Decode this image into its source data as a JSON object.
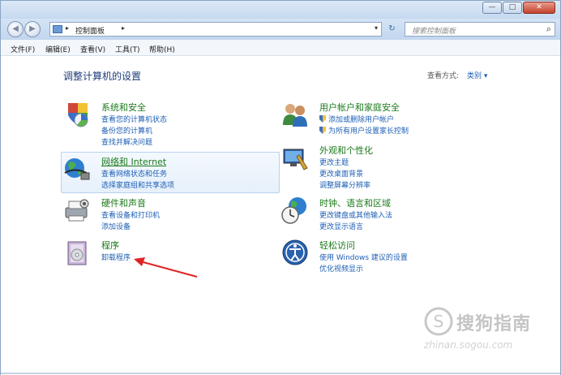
{
  "window": {
    "minimize_glyph": "—",
    "maximize_glyph": "□",
    "close_glyph": "✕"
  },
  "nav": {
    "back_glyph": "◀",
    "forward_glyph": "▶",
    "address_sep": "▸",
    "address_text": "控制面板",
    "address_sep2": "▸",
    "dropdown_glyph": "▾",
    "refresh_glyph": "↻",
    "search_placeholder": "搜索控制面板",
    "search_glyph": "⌕"
  },
  "menu": [
    "文件(F)",
    "编辑(E)",
    "查看(V)",
    "工具(T)",
    "帮助(H)"
  ],
  "page": {
    "heading": "调整计算机的设置",
    "view_label": "查看方式:",
    "view_value": "类别 ▾"
  },
  "categories": [
    {
      "title": "系统和安全",
      "links": [
        "查看您的计算机状态",
        "备份您的计算机",
        "查找并解决问题"
      ],
      "icon": "system-security-icon"
    },
    {
      "title": "网络和 Internet",
      "links": [
        "查看网络状态和任务",
        "选择家庭组和共享选项"
      ],
      "icon": "network-icon"
    },
    {
      "title": "硬件和声音",
      "links": [
        "查看设备和打印机",
        "添加设备"
      ],
      "icon": "hardware-sound-icon"
    },
    {
      "title": "程序",
      "links": [
        "卸载程序"
      ],
      "icon": "programs-icon"
    },
    {
      "title": "用户帐户和家庭安全",
      "links": [
        "添加或删除用户帐户",
        "为所有用户设置家长控制"
      ],
      "icon": "user-accounts-icon"
    },
    {
      "title": "外观和个性化",
      "links": [
        "更改主题",
        "更改桌面背景",
        "调整屏幕分辨率"
      ],
      "icon": "appearance-icon"
    },
    {
      "title": "时钟、语言和区域",
      "links": [
        "更改键盘或其他输入法",
        "更改显示语言"
      ],
      "icon": "clock-region-icon"
    },
    {
      "title": "轻松访问",
      "links": [
        "使用 Windows 建议的设置",
        "优化视频显示"
      ],
      "icon": "ease-of-access-icon"
    }
  ],
  "watermark": {
    "brand": "搜狗指南",
    "url": "zhinan.sogou.com"
  },
  "colors": {
    "category_title": "#1a7a1a",
    "link": "#1e5fb4",
    "annotation_arrow": "#e02424"
  }
}
